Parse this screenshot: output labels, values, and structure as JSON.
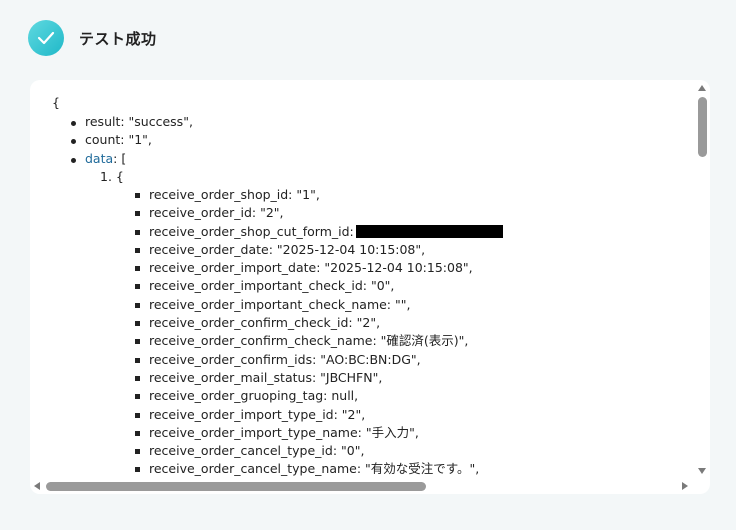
{
  "header": {
    "title": "テスト成功",
    "status_icon": "check-icon",
    "accent_color": "#1fb8c8"
  },
  "json_view": {
    "open_brace": "{",
    "top_items": [
      "result: \"success\",",
      "count: \"1\","
    ],
    "data_key": "data",
    "data_suffix": ": [",
    "ordered_item_prefix": "1. {",
    "fields": [
      "receive_order_shop_id: \"1\",",
      "receive_order_id: \"2\",",
      "receive_order_shop_cut_form_id:",
      "receive_order_date: \"2025-12-04 10:15:08\",",
      "receive_order_import_date: \"2025-12-04 10:15:08\",",
      "receive_order_important_check_id: \"0\",",
      "receive_order_important_check_name: \"\",",
      "receive_order_confirm_check_id: \"2\",",
      "receive_order_confirm_check_name: \"確認済(表示)\",",
      "receive_order_confirm_ids: \"AO:BC:BN:DG\",",
      "receive_order_mail_status: \"JBCHFN\",",
      "receive_order_gruoping_tag: null,",
      "receive_order_import_type_id: \"2\",",
      "receive_order_import_type_name: \"手入力\",",
      "receive_order_cancel_type_id: \"0\",",
      "receive_order_cancel_type_name: \"有効な受注です。\","
    ]
  }
}
